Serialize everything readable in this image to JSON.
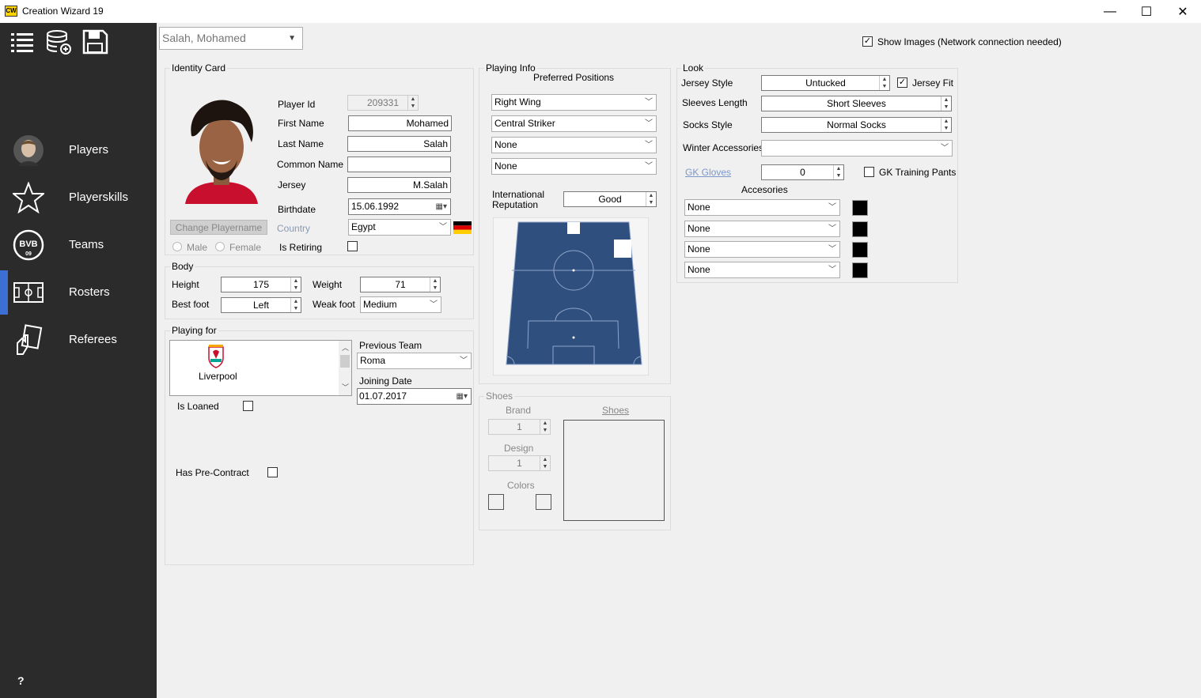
{
  "window": {
    "app_icon_text": "CW",
    "title": "Creation Wizard 19",
    "minimize": "—",
    "maximize": "☐",
    "close": "✕"
  },
  "sidebar": {
    "nav": [
      {
        "label": "Players",
        "icon": "player-face-icon"
      },
      {
        "label": "Playerskills",
        "icon": "star-icon"
      },
      {
        "label": "Teams",
        "icon": "bvb-crest-icon"
      },
      {
        "label": "Rosters",
        "icon": "pitch-icon"
      },
      {
        "label": "Referees",
        "icon": "referee-card-icon"
      }
    ],
    "active_index": 3,
    "help": "?"
  },
  "header": {
    "player_select": "Salah, Mohamed",
    "show_images_label": "Show Images (Network connection needed)",
    "show_images_checked": true
  },
  "identity": {
    "title": "Identity Card",
    "player_id_label": "Player Id",
    "player_id": "209331",
    "first_name_label": "First Name",
    "first_name": "Mohamed",
    "last_name_label": "Last Name",
    "last_name": "Salah",
    "common_name_label": "Common Name",
    "common_name": "",
    "jersey_label": "Jersey",
    "jersey": "M.Salah",
    "birthdate_label": "Birthdate",
    "birthdate": "15.06.1992",
    "change_playername": "Change Playername",
    "country_label": "Country",
    "country": "Egypt",
    "male_label": "Male",
    "female_label": "Female",
    "is_retiring_label": "Is Retiring"
  },
  "body": {
    "title": "Body",
    "height_label": "Height",
    "height": "175",
    "weight_label": "Weight",
    "weight": "71",
    "best_foot_label": "Best foot",
    "best_foot": "Left",
    "weak_foot_label": "Weak foot",
    "weak_foot": "Medium"
  },
  "playing_for": {
    "title": "Playing for",
    "team": "Liverpool",
    "previous_team_label": "Previous Team",
    "previous_team": "Roma",
    "joining_date_label": "Joining Date",
    "joining_date": "01.07.2017",
    "is_loaned_label": "Is Loaned",
    "pre_contract_label": "Has Pre-Contract"
  },
  "playing_info": {
    "title": "Playing Info",
    "preferred_positions_label": "Preferred Positions",
    "positions": [
      "Right Wing",
      "Central Striker",
      "None",
      "None"
    ],
    "int_rep_label_1": "International",
    "int_rep_label_2": "Reputation",
    "int_rep": "Good"
  },
  "shoes": {
    "title": "Shoes",
    "brand_label": "Brand",
    "brand": "1",
    "design_label": "Design",
    "design": "1",
    "colors_label": "Colors",
    "shoes_link": "Shoes"
  },
  "look": {
    "title": "Look",
    "jersey_style_label": "Jersey Style",
    "jersey_style": "Untucked",
    "jersey_fit_label": "Jersey Fit",
    "jersey_fit_checked": true,
    "sleeves_label": "Sleeves Length",
    "sleeves": "Short Sleeves",
    "socks_label": "Socks Style",
    "socks": "Normal Socks",
    "winter_label": "Winter Accessories",
    "winter": "",
    "gk_gloves_label": "GK Gloves",
    "gk_gloves": "0",
    "gk_pants_label": "GK Training Pants",
    "accessories_label": "Accesories",
    "accessories": [
      "None",
      "None",
      "None",
      "None"
    ],
    "accessory_color": "#000000"
  },
  "colors": {
    "sidebar_bg": "#2b2b2b",
    "active_bar": "#3b6fd4",
    "pitch": "#2f4f7f"
  }
}
